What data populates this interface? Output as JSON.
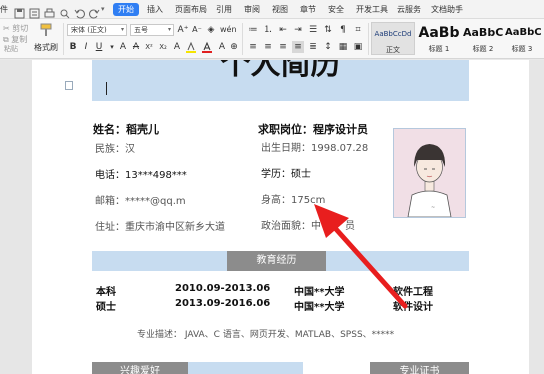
{
  "menubar": {
    "left_fragment": "件",
    "tabs": [
      "开始",
      "插入",
      "页面布局",
      "引用",
      "审阅",
      "视图",
      "章节",
      "安全",
      "开发工具",
      "云服务",
      "文档助手"
    ],
    "active_tab_index": 0,
    "active_color": "#2f7ef3"
  },
  "ribbon": {
    "cut": "剪切",
    "copy": "复制",
    "format_painter": "格式刷",
    "paste": "粘贴",
    "font_name": "宋体 (正文)",
    "font_size": "五号",
    "font_color": "#e02020",
    "highlight_color": "#f5e400",
    "styles": [
      {
        "preview": "AaBbCcDd",
        "label": "正文"
      },
      {
        "preview": "AaBb",
        "label": "标题 1"
      },
      {
        "preview": "AaBbC",
        "label": "标题 2"
      },
      {
        "preview": "AaBbC",
        "label": "标题 3"
      }
    ]
  },
  "resume": {
    "title": "个人简历",
    "accent_band_color": "#c7dcf0",
    "name_line": "姓名：稻壳儿",
    "position_line": "求职岗位：程序设计员",
    "ethnicity": "民族：汉",
    "birth": "出生日期：1998.07.28",
    "phone": "电话：13***498***",
    "education": "学历：硕士",
    "email": "邮箱：*****@qq.m",
    "height": "身高：175cm",
    "address": "住址：重庆市渝中区新乡大道",
    "politics": "政治面貌：中",
    "politics_tail": "员",
    "edu_section": "教育经历",
    "edu_rows": [
      {
        "degree": "本科",
        "period": "2010.09-2013.06",
        "school": "中国**大学",
        "major": "软件工程"
      },
      {
        "degree": "硕士",
        "period": "2013.09-2016.06",
        "school": "中国**大学",
        "major": "软件设计"
      }
    ],
    "skills": "专业描述：  JAVA、C 语言、网页开发、MATLAB、SPSS、*****",
    "hobby_section": "兴趣爱好",
    "cert_section": "专业证书"
  },
  "annotation": {
    "arrow_color": "#e81e1e"
  }
}
